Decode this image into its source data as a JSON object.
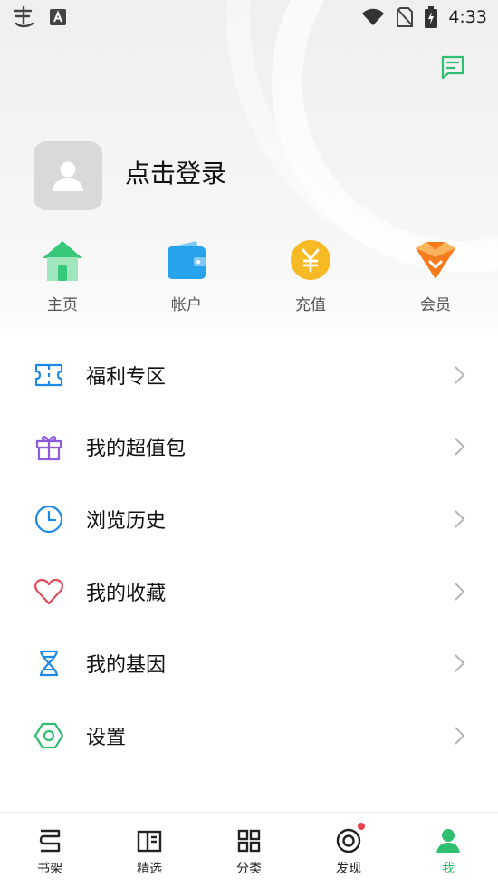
{
  "status_bar": {
    "time": "4:33"
  },
  "profile": {
    "login_prompt": "点击登录"
  },
  "quick_actions": [
    {
      "label": "主页",
      "icon": "home-icon"
    },
    {
      "label": "帐户",
      "icon": "wallet-icon"
    },
    {
      "label": "充值",
      "icon": "yen-coin-icon"
    },
    {
      "label": "会员",
      "icon": "vip-badge-icon"
    }
  ],
  "menu": [
    {
      "label": "福利专区",
      "icon": "ticket-icon"
    },
    {
      "label": "我的超值包",
      "icon": "gift-icon"
    },
    {
      "label": "浏览历史",
      "icon": "clock-icon"
    },
    {
      "label": "我的收藏",
      "icon": "heart-icon"
    },
    {
      "label": "我的基因",
      "icon": "dna-icon"
    },
    {
      "label": "设置",
      "icon": "settings-hex-icon"
    }
  ],
  "bottom_nav": [
    {
      "label": "书架",
      "icon": "bookshelf-icon",
      "active": false
    },
    {
      "label": "精选",
      "icon": "open-book-icon",
      "active": false
    },
    {
      "label": "分类",
      "icon": "grid-icon",
      "active": false
    },
    {
      "label": "发现",
      "icon": "discover-icon",
      "active": false,
      "badge": true
    },
    {
      "label": "我",
      "icon": "user-icon",
      "active": true
    }
  ],
  "colors": {
    "accent": "#2fbf71",
    "badge": "#e8424e",
    "wallet_blue": "#27a3ec",
    "coin_yellow": "#f7b924",
    "vip_orange": "#f77b1c"
  }
}
